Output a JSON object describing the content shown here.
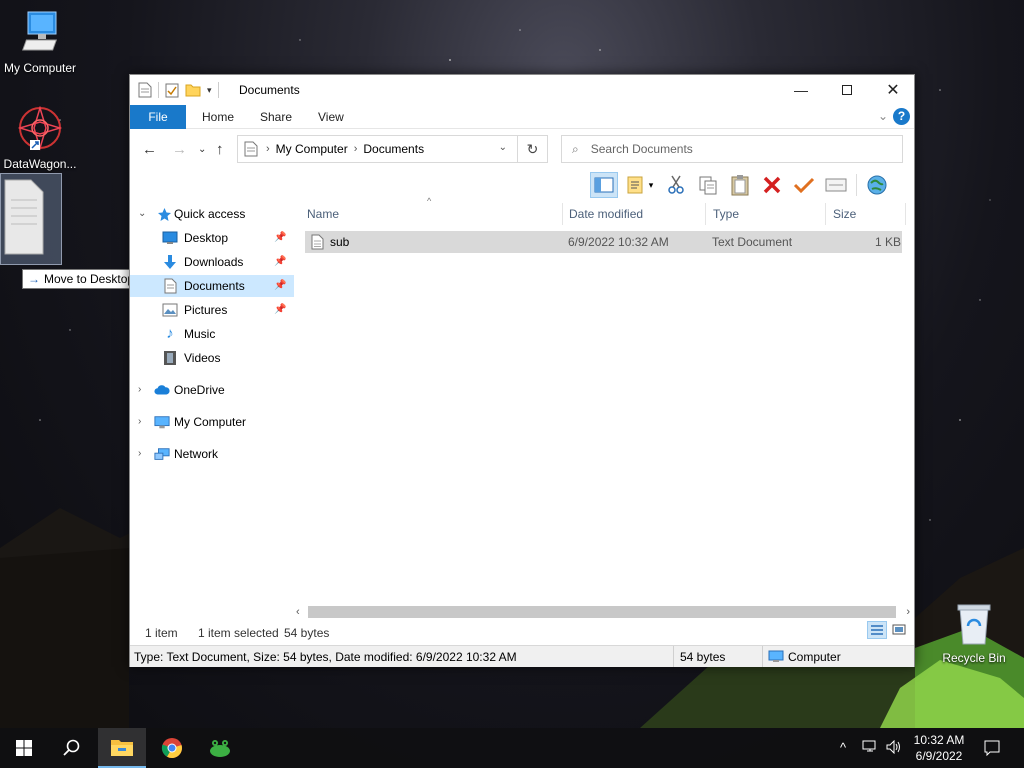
{
  "desktop": {
    "icons": [
      {
        "label": "My Computer"
      },
      {
        "label": "DataWagon..."
      },
      {
        "label": "Recycle Bin"
      }
    ],
    "drag_tooltip": "Move to Desktop"
  },
  "window": {
    "title": "Documents",
    "ribbon_tabs": [
      "File",
      "Home",
      "Share",
      "View"
    ],
    "help_label": "?",
    "breadcrumb": [
      "My Computer",
      "Documents"
    ],
    "search_placeholder": "Search Documents",
    "nav": {
      "quick_access": "Quick access",
      "items": [
        {
          "label": "Desktop",
          "pinned": true
        },
        {
          "label": "Downloads",
          "pinned": true
        },
        {
          "label": "Documents",
          "pinned": true,
          "selected": true
        },
        {
          "label": "Pictures",
          "pinned": true
        },
        {
          "label": "Music",
          "pinned": false
        },
        {
          "label": "Videos",
          "pinned": false
        }
      ],
      "roots": [
        {
          "label": "OneDrive"
        },
        {
          "label": "My Computer"
        },
        {
          "label": "Network"
        }
      ]
    },
    "columns": [
      "Name",
      "Date modified",
      "Type",
      "Size"
    ],
    "files": [
      {
        "name": "sub",
        "date": "6/9/2022 10:32 AM",
        "type": "Text Document",
        "size": "1 KB"
      }
    ],
    "status": {
      "count": "1 item",
      "selected": "1 item selected",
      "size": "54 bytes"
    },
    "infobar": {
      "details": "Type: Text Document, Size: 54 bytes, Date modified: 6/9/2022 10:32 AM",
      "size": "54 bytes",
      "location": "Computer"
    }
  },
  "taskbar": {
    "time": "10:32 AM",
    "date": "6/9/2022"
  },
  "colors": {
    "accent": "#1979ca",
    "selection": "#cce8ff",
    "row_selected": "#d9d9d9",
    "taskbar": "#101012"
  }
}
